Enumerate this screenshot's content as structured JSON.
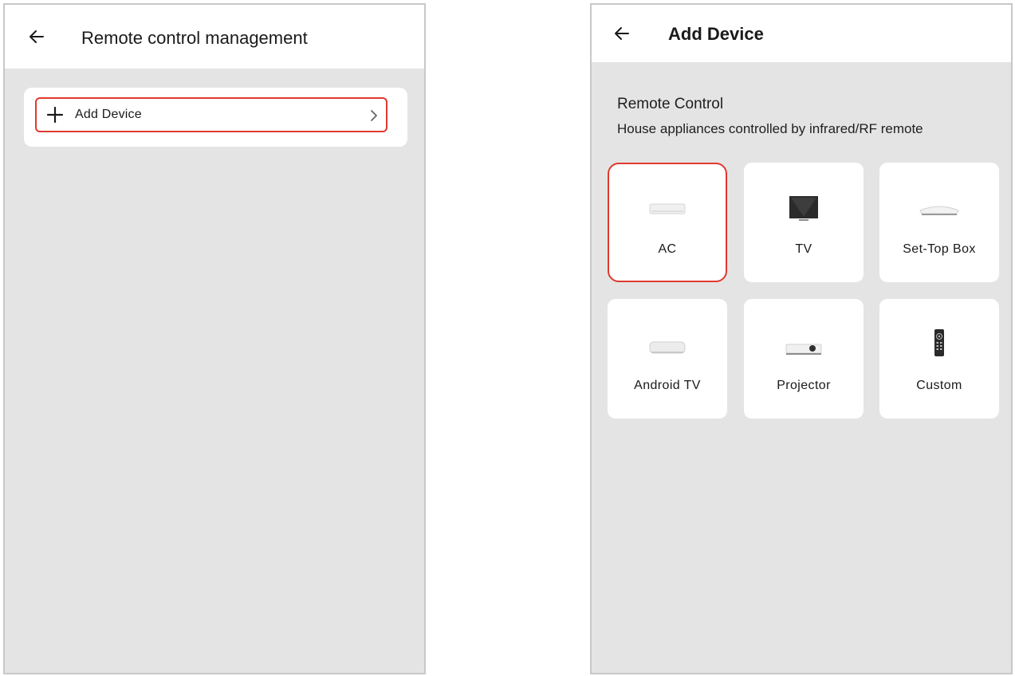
{
  "left_screen": {
    "title": "Remote control management",
    "add_device_label": "Add Device"
  },
  "right_screen": {
    "title": "Add Device",
    "section_title": "Remote Control",
    "section_subtitle": "House appliances controlled by infrared/RF remote",
    "devices": [
      {
        "label": "AC",
        "icon": "air-conditioner-icon",
        "selected": true
      },
      {
        "label": "TV",
        "icon": "tv-icon",
        "selected": false
      },
      {
        "label": "Set-Top Box",
        "icon": "set-top-box-icon",
        "selected": false
      },
      {
        "label": "Android TV",
        "icon": "android-tv-box-icon",
        "selected": false
      },
      {
        "label": "Projector",
        "icon": "projector-icon",
        "selected": false
      },
      {
        "label": "Custom",
        "icon": "remote-icon",
        "selected": false
      }
    ]
  },
  "colors": {
    "highlight": "#e0392f",
    "background": "#e4e4e4",
    "card": "#ffffff"
  }
}
